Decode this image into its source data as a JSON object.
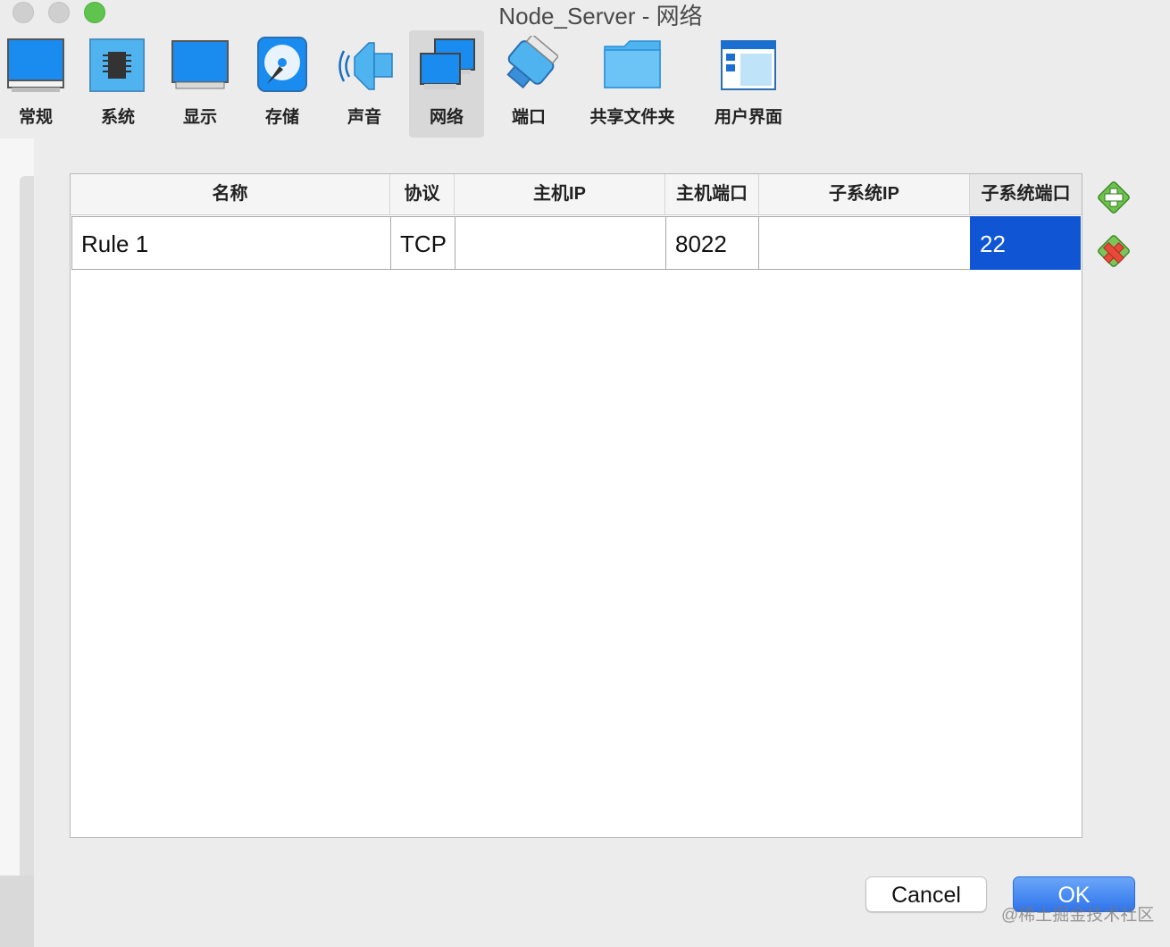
{
  "window": {
    "title": "Node_Server - 网络"
  },
  "toolbar": {
    "items": [
      {
        "label": "常规",
        "icon": "general-monitor-icon"
      },
      {
        "label": "系统",
        "icon": "system-chip-icon"
      },
      {
        "label": "显示",
        "icon": "display-monitor-icon"
      },
      {
        "label": "存储",
        "icon": "storage-disk-icon"
      },
      {
        "label": "声音",
        "icon": "audio-speaker-icon"
      },
      {
        "label": "网络",
        "icon": "network-icon",
        "active": true
      },
      {
        "label": "端口",
        "icon": "serial-port-icon"
      },
      {
        "label": "共享文件夹",
        "icon": "shared-folder-icon"
      },
      {
        "label": "用户界面",
        "icon": "user-interface-icon"
      }
    ]
  },
  "table": {
    "columns": [
      "名称",
      "协议",
      "主机IP",
      "主机端口",
      "子系统IP",
      "子系统端口"
    ],
    "rows": [
      {
        "name": "Rule 1",
        "protocol": "TCP",
        "host_ip": "",
        "host_port": "8022",
        "guest_ip": "",
        "guest_port": "22"
      }
    ],
    "selected_column": "子系统端口"
  },
  "side_actions": {
    "add": "add-rule-icon",
    "remove": "remove-rule-icon"
  },
  "buttons": {
    "cancel": "Cancel",
    "ok": "OK"
  },
  "watermark": "@稀土掘金技术社区",
  "colors": {
    "selection": "#0f55d4",
    "ok_button": "#2f74ec",
    "close_light": "#cfcfcf",
    "zoom_light": "#5ec44e"
  }
}
